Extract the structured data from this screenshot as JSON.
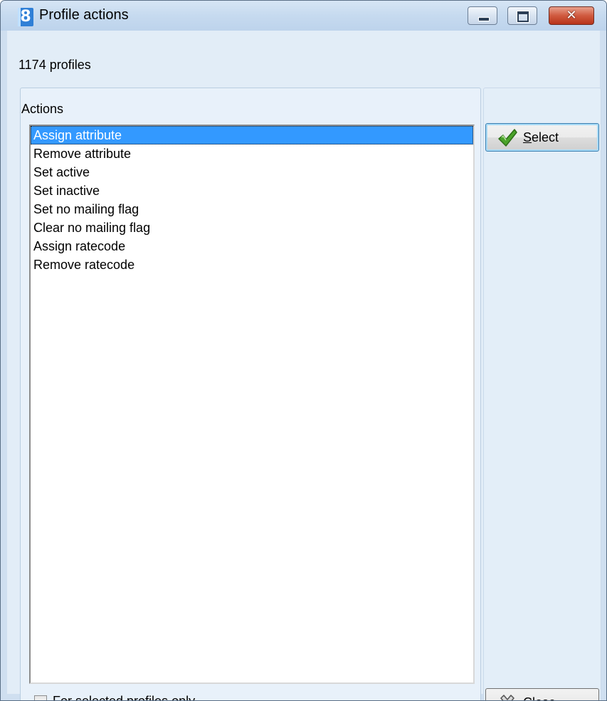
{
  "window": {
    "title": "Profile actions",
    "app_icon_text": "8"
  },
  "status": {
    "profile_count": "1174 profiles"
  },
  "actions_panel": {
    "header": "Actions",
    "items": [
      {
        "label": "Assign attribute",
        "selected": true
      },
      {
        "label": "Remove attribute"
      },
      {
        "label": "Set active"
      },
      {
        "label": "Set inactive"
      },
      {
        "label": "Set no mailing flag"
      },
      {
        "label": "Clear no mailing flag"
      },
      {
        "label": "Assign ratecode"
      },
      {
        "label": "Remove ratecode"
      }
    ]
  },
  "buttons": {
    "select": {
      "mnemonic": "S",
      "rest": "elect",
      "icon": "green-check-icon"
    },
    "close": {
      "mnemonic": "C",
      "rest": "lose",
      "icon": "close-x-icon"
    }
  },
  "options": {
    "selected_only_label": "For selected profiles only",
    "selected_only_checked": false
  },
  "colors": {
    "selection": "#3399ff",
    "client_background": "#e2edf7",
    "close_button": "#c44a2e"
  }
}
